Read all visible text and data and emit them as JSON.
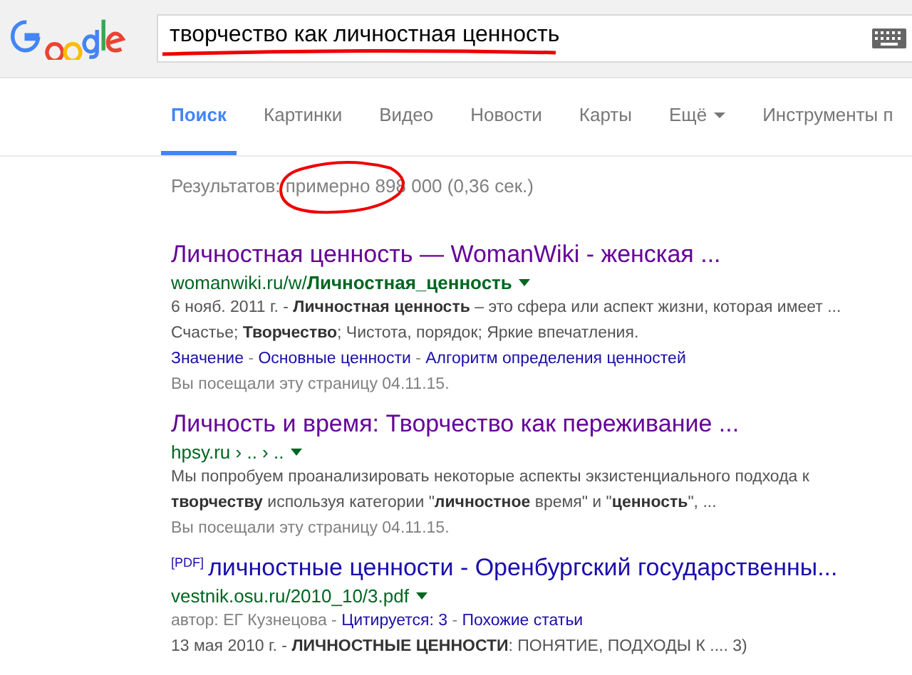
{
  "search": {
    "value": "творчество как личностная ценность"
  },
  "tabs": [
    {
      "label": "Поиск",
      "selected": true,
      "kind": "tab"
    },
    {
      "label": "Картинки",
      "selected": false,
      "kind": "tab"
    },
    {
      "label": "Видео",
      "selected": false,
      "kind": "tab"
    },
    {
      "label": "Новости",
      "selected": false,
      "kind": "tab"
    },
    {
      "label": "Карты",
      "selected": false,
      "kind": "tab"
    },
    {
      "label": "Ещё",
      "selected": false,
      "kind": "menu"
    },
    {
      "label": "Инструменты п",
      "selected": false,
      "kind": "tab"
    }
  ],
  "result_stats": "Результатов: примерно 898 000 (0,36 сек.)",
  "results": [
    {
      "title": "Личностная ценность — WomanWiki - женская ...",
      "visited": true,
      "url": "womanwiki.ru/w/**Личностная_ценность**",
      "snippet": "6 нояб. 2011 г. - **Личностная ценность** – это сфера или аспект жизни, которая имеет ... Счастье; **Творчество**; Чистота, порядок; Яркие впечатления.",
      "meta_line": [
        {
          "kind": "link",
          "text": "Значение"
        },
        {
          "kind": "text",
          "text": " - "
        },
        {
          "kind": "link",
          "text": "Основные ценности"
        },
        {
          "kind": "text",
          "text": " - "
        },
        {
          "kind": "link",
          "text": "Алгоритм определения ценностей"
        }
      ],
      "visited_note": "Вы посещали эту страницу 04.11.15."
    },
    {
      "title": "Личность и время: Творчество как переживание ...",
      "visited": true,
      "url": "hpsy.ru › .. › ..",
      "snippet": "Мы попробуем проанализировать некоторые аспекты экзистенциального подхода к **творчеству** используя категории \"**личностное** время\" и \"**ценность**\",  ...",
      "visited_note": "Вы посещали эту страницу 04.11.15."
    },
    {
      "file_type": "[PDF]",
      "title": "личностные ценности - Оренбургский государственны...",
      "visited": false,
      "url": "vestnik.osu.ru/2010_10/3.pdf",
      "meta_line": [
        {
          "kind": "text",
          "text": "автор: ЕГ Кузнецова - "
        },
        {
          "kind": "link",
          "text": "Цитируется: 3"
        },
        {
          "kind": "text",
          "text": " - "
        },
        {
          "kind": "link",
          "text": "Похожие статьи"
        }
      ],
      "snippet": "13 мая 2010 г. - **ЛИЧНОСТНЫЕ ЦЕННОСТИ**: ПОНЯТИЕ, ПОДХОДЫ К .... 3)"
    }
  ]
}
